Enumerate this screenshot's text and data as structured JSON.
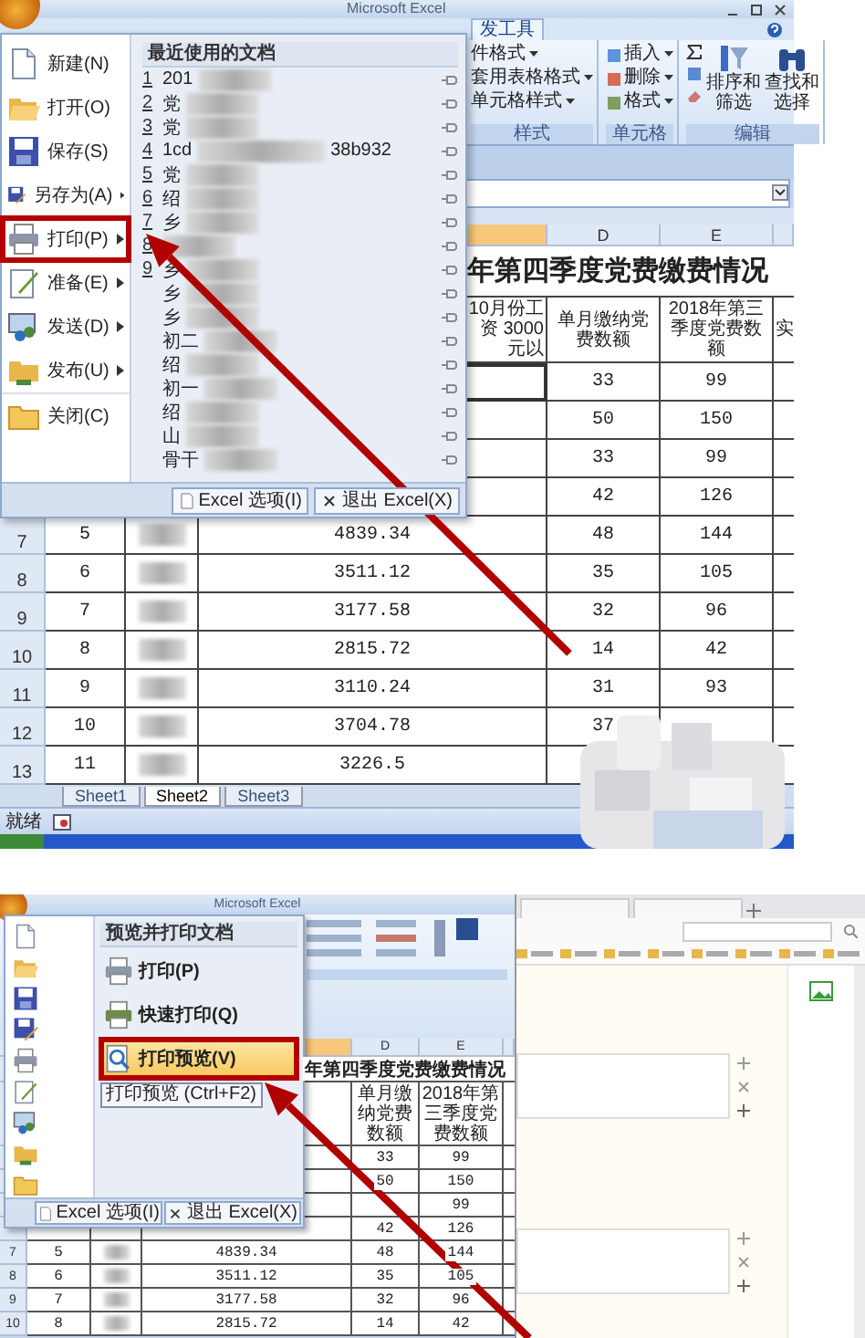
{
  "top_screen": {
    "window_title": "Microsoft Excel",
    "ribbon_tab": "发工具",
    "ribbon_groups": [
      {
        "label": "样式",
        "kind": "styles",
        "items": [
          "件格式",
          "套用表格格式",
          "单元格样式"
        ]
      },
      {
        "label": "单元格",
        "kind": "cells",
        "items": [
          "插入",
          "删除",
          "格式"
        ]
      },
      {
        "label": "编辑",
        "kind": "editing",
        "items": [
          "排序和筛选",
          "查找和选择"
        ]
      }
    ],
    "office_menu": {
      "commands": [
        {
          "label": "新建(N)",
          "kind": "new",
          "submenu": false,
          "highlighted": false
        },
        {
          "label": "打开(O)",
          "kind": "open",
          "submenu": false,
          "highlighted": false
        },
        {
          "label": "保存(S)",
          "kind": "save",
          "submenu": false,
          "highlighted": false
        },
        {
          "label": "另存为(A)",
          "kind": "saveas",
          "submenu": true,
          "highlighted": false
        },
        {
          "label": "打印(P)",
          "kind": "print",
          "submenu": true,
          "highlighted": true
        },
        {
          "label": "准备(E)",
          "kind": "prepare",
          "submenu": true,
          "highlighted": false
        },
        {
          "label": "发送(D)",
          "kind": "send",
          "submenu": true,
          "highlighted": false
        },
        {
          "label": "发布(U)",
          "kind": "publish",
          "submenu": true,
          "highlighted": false
        },
        {
          "label": "关闭(C)",
          "kind": "close",
          "submenu": false,
          "highlighted": false
        }
      ],
      "recent_title": "最近使用的文档",
      "recent": [
        {
          "number": "1",
          "name": "201"
        },
        {
          "number": "2",
          "name": "党"
        },
        {
          "number": "3",
          "name": "党"
        },
        {
          "number": "4",
          "name": "1cd",
          "tail": "38b932"
        },
        {
          "number": "5",
          "name": "党"
        },
        {
          "number": "6",
          "name": "绍"
        },
        {
          "number": "7",
          "name": "乡"
        },
        {
          "number": "8"
        },
        {
          "number": "9",
          "name": "乡"
        },
        {
          "name": "乡"
        },
        {
          "name": "乡"
        },
        {
          "name": "初二"
        },
        {
          "name": "绍"
        },
        {
          "name": "初一"
        },
        {
          "name": "绍"
        },
        {
          "name": "山"
        },
        {
          "name": "骨干"
        }
      ],
      "footer_buttons": [
        {
          "label": "Excel 选项(I)",
          "kind": "options"
        },
        {
          "label": "退出 Excel(X)",
          "kind": "exit"
        }
      ]
    },
    "sheet": {
      "columns": [
        {
          "selected": true
        },
        {
          "label": "D",
          "selected": false
        },
        {
          "label": "E",
          "selected": false
        }
      ],
      "title": "年第四季度党费缴费情况",
      "headers": [
        "10月份工资 3000元以",
        "单月缴纳党费数额",
        "2018年第三季度党费数额",
        "实"
      ],
      "rows": [
        {
          "d": "33",
          "e": "99"
        },
        {
          "d": "50",
          "e": "150"
        },
        {
          "d": "33",
          "e": "99"
        },
        {
          "d": "42",
          "e": "126"
        },
        {
          "row": "7",
          "seq": "5",
          "amount": "4839.34",
          "d": "48",
          "e": "144"
        },
        {
          "row": "8",
          "seq": "6",
          "amount": "3511.12",
          "d": "35",
          "e": "105"
        },
        {
          "row": "9",
          "seq": "7",
          "amount": "3177.58",
          "d": "32",
          "e": "96"
        },
        {
          "row": "10",
          "seq": "8",
          "amount": "2815.72",
          "d": "14",
          "e": "42"
        },
        {
          "row": "11",
          "seq": "9",
          "amount": "3110.24",
          "d": "31",
          "e": "93"
        },
        {
          "row": "12",
          "seq": "10",
          "amount": "3704.78",
          "d": "37"
        },
        {
          "row": "13",
          "seq": "11",
          "amount": "3226.5"
        }
      ],
      "sheet_tabs": [
        {
          "label": "Sheet1",
          "selected": false
        },
        {
          "label": "Sheet2",
          "selected": true
        },
        {
          "label": "Sheet3",
          "selected": false
        }
      ],
      "status": "就绪"
    }
  },
  "bottom_screen": {
    "window_title": "Microsoft Excel",
    "print_menu": {
      "title": "预览并打印文档",
      "items": [
        {
          "label": "打印(P)",
          "kind": "print",
          "highlighted": false
        },
        {
          "label": "快速打印(Q)",
          "kind": "quick",
          "highlighted": false
        },
        {
          "label": "打印预览(V)",
          "kind": "preview",
          "highlighted": true
        }
      ],
      "tooltip": "打印预览 (Ctrl+F2)",
      "footer_buttons": [
        {
          "label": "Excel 选项(I)",
          "kind": "options"
        },
        {
          "label": "退出 Excel(X)",
          "kind": "exit"
        }
      ]
    },
    "sheet": {
      "columns": [
        {
          "selected": true
        },
        {
          "label": "D",
          "selected": false
        },
        {
          "label": "E",
          "selected": false
        }
      ],
      "title": "年第四季度党费缴费情况",
      "headers": [
        "单月缴纳党费数额",
        "2018年第三季度党费数额"
      ],
      "rows": [
        {
          "d": "33",
          "e": "99"
        },
        {
          "d": "50",
          "e": "150"
        },
        {
          "e": "99"
        },
        {
          "d": "42",
          "e": "126"
        },
        {
          "row": "7",
          "seq": "5",
          "amount": "4839.34",
          "d": "48",
          "e": "144"
        },
        {
          "row": "8",
          "seq": "6",
          "amount": "3511.12",
          "d": "35",
          "e": "105"
        },
        {
          "row": "9",
          "seq": "7",
          "amount": "3177.58",
          "d": "32",
          "e": "96"
        },
        {
          "row": "10",
          "seq": "8",
          "amount": "2815.72",
          "d": "14",
          "e": "42"
        }
      ]
    }
  }
}
